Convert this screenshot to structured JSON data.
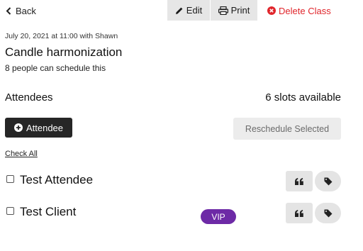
{
  "toolbar": {
    "back_label": "Back",
    "edit_label": "Edit",
    "print_label": "Print",
    "delete_label": "Delete Class",
    "delete_color": "#e0252b"
  },
  "class_info": {
    "date_line": "July 20, 2021 at 11:00 with Shawn",
    "title": "Candle harmonization",
    "capacity_text": "8 people can schedule this"
  },
  "attendees": {
    "heading": "Attendees",
    "slots_text": "6 slots available",
    "add_button_label": "Attendee",
    "reschedule_label": "Reschedule Selected",
    "check_all_label": "Check All",
    "list": [
      {
        "name": "Test Attendee",
        "checked": false,
        "badge": ""
      },
      {
        "name": "Test Client",
        "checked": false,
        "badge": "VIP"
      }
    ]
  },
  "icons": {
    "back": "chevron-left-icon",
    "edit": "pencil-icon",
    "print": "printer-icon",
    "delete": "times-circle-icon",
    "add": "plus-circle-icon",
    "notes": "quote-icon",
    "tags": "tag-icon"
  },
  "colors": {
    "vip_badge": "#6d2aa6",
    "primary_button": "#262626"
  }
}
